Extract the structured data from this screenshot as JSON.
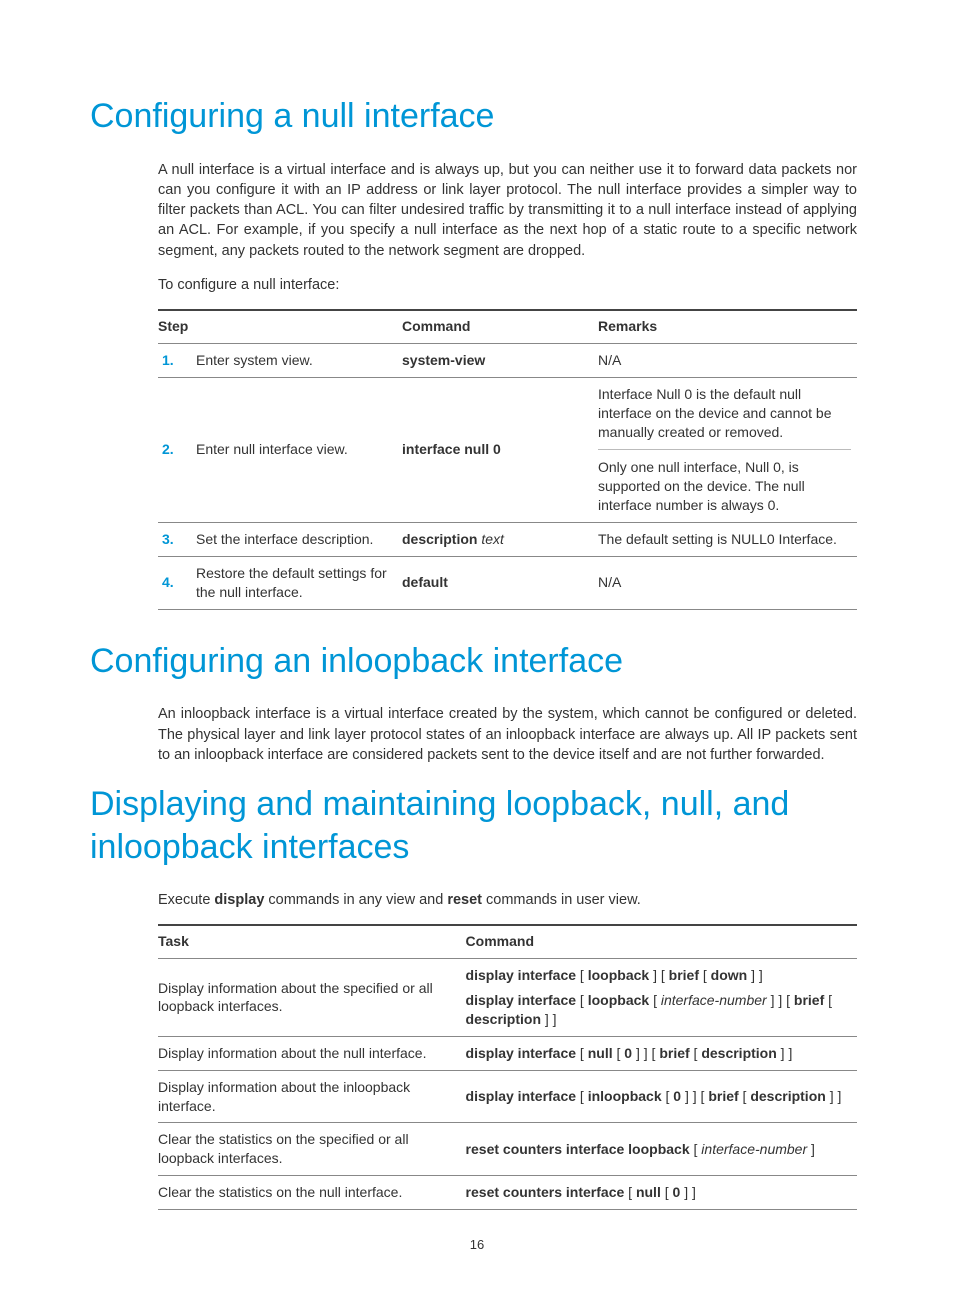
{
  "pageNumber": "16",
  "section1": {
    "heading": "Configuring a null interface",
    "para1": "A null interface is a virtual interface and is always up, but you can neither use it to forward data packets nor can you configure it with an IP address or link layer protocol. The null interface provides a simpler way to filter packets than ACL. You can filter undesired traffic by transmitting it to a null interface instead of applying an ACL. For example, if you specify a null interface as the next hop of a static route to a specific network segment, any packets routed to the network segment are dropped.",
    "para2": "To configure a null interface:",
    "table": {
      "headers": {
        "c1": "Step",
        "c2": "Command",
        "c3": "Remarks"
      },
      "rows": [
        {
          "num": "1.",
          "desc": "Enter system view.",
          "cmd_bold": "system-view",
          "cmd_ital": "",
          "rem1": "N/A",
          "rem2": ""
        },
        {
          "num": "2.",
          "desc": "Enter null interface view.",
          "cmd_bold": "interface null 0",
          "cmd_ital": "",
          "rem1": "Interface Null 0 is the default null interface on the device and cannot be manually created or removed.",
          "rem2": "Only one null interface, Null 0, is supported on the device. The null interface number is always 0."
        },
        {
          "num": "3.",
          "desc": "Set the interface description.",
          "cmd_bold": "description",
          "cmd_ital": " text",
          "rem1": "The default setting is NULL0 Interface.",
          "rem2": ""
        },
        {
          "num": "4.",
          "desc": "Restore the default settings for the null interface.",
          "cmd_bold": "default",
          "cmd_ital": "",
          "rem1": "N/A",
          "rem2": ""
        }
      ]
    }
  },
  "section2": {
    "heading": "Configuring an inloopback interface",
    "para1": "An inloopback interface is a virtual interface created by the system, which cannot be configured or deleted. The physical layer and link layer protocol states of an inloopback interface are always up. All IP packets sent to an inloopback interface are considered packets sent to the device itself and are not further forwarded."
  },
  "section3": {
    "heading": "Displaying and maintaining loopback, null, and inloopback interfaces",
    "exec_pre": "Execute ",
    "exec_b1": "display",
    "exec_mid": " commands in any view and ",
    "exec_b2": "reset",
    "exec_post": " commands in user view.",
    "table": {
      "headers": {
        "c1": "Task",
        "c2": "Command"
      },
      "rows": [
        {
          "task": "Display information about the specified or all loopback interfaces.",
          "cmd_parts": [
            {
              "t": "b",
              "v": "display interface"
            },
            {
              "t": "p",
              "v": " [ "
            },
            {
              "t": "b",
              "v": "loopback"
            },
            {
              "t": "p",
              "v": " ] [ "
            },
            {
              "t": "b",
              "v": "brief"
            },
            {
              "t": "p",
              "v": " [ "
            },
            {
              "t": "b",
              "v": "down"
            },
            {
              "t": "p",
              "v": " ] ]"
            }
          ],
          "cmd2_parts": [
            {
              "t": "b",
              "v": "display interface"
            },
            {
              "t": "p",
              "v": " [ "
            },
            {
              "t": "b",
              "v": "loopback"
            },
            {
              "t": "p",
              "v": " [ "
            },
            {
              "t": "i",
              "v": "interface-number"
            },
            {
              "t": "p",
              "v": " ] ] [ "
            },
            {
              "t": "b",
              "v": "brief"
            },
            {
              "t": "p",
              "v": " [ "
            },
            {
              "t": "b",
              "v": "description"
            },
            {
              "t": "p",
              "v": " ] ]"
            }
          ]
        },
        {
          "task": "Display information about the null interface.",
          "cmd_parts": [
            {
              "t": "b",
              "v": "display interface"
            },
            {
              "t": "p",
              "v": " [ "
            },
            {
              "t": "b",
              "v": "null"
            },
            {
              "t": "p",
              "v": " [ "
            },
            {
              "t": "b",
              "v": "0"
            },
            {
              "t": "p",
              "v": " ] ] [ "
            },
            {
              "t": "b",
              "v": "brief"
            },
            {
              "t": "p",
              "v": " [ "
            },
            {
              "t": "b",
              "v": "description"
            },
            {
              "t": "p",
              "v": " ] ]"
            }
          ]
        },
        {
          "task": "Display information about the inloopback interface.",
          "cmd_parts": [
            {
              "t": "b",
              "v": "display interface"
            },
            {
              "t": "p",
              "v": " [ "
            },
            {
              "t": "b",
              "v": "inloopback"
            },
            {
              "t": "p",
              "v": " [ "
            },
            {
              "t": "b",
              "v": "0"
            },
            {
              "t": "p",
              "v": " ] ] [ "
            },
            {
              "t": "b",
              "v": "brief"
            },
            {
              "t": "p",
              "v": " [ "
            },
            {
              "t": "b",
              "v": "description"
            },
            {
              "t": "p",
              "v": " ] ]"
            }
          ]
        },
        {
          "task": "Clear the statistics on the specified or all loopback interfaces.",
          "cmd_parts": [
            {
              "t": "b",
              "v": "reset counters interface loopback"
            },
            {
              "t": "p",
              "v": " [ "
            },
            {
              "t": "i",
              "v": "interface-number"
            },
            {
              "t": "p",
              "v": " ]"
            }
          ]
        },
        {
          "task": "Clear the statistics on the null interface.",
          "cmd_parts": [
            {
              "t": "b",
              "v": "reset counters interface"
            },
            {
              "t": "p",
              "v": " [ "
            },
            {
              "t": "b",
              "v": "null"
            },
            {
              "t": "p",
              "v": " [ "
            },
            {
              "t": "b",
              "v": "0"
            },
            {
              "t": "p",
              "v": " ] ]"
            }
          ]
        }
      ]
    }
  }
}
